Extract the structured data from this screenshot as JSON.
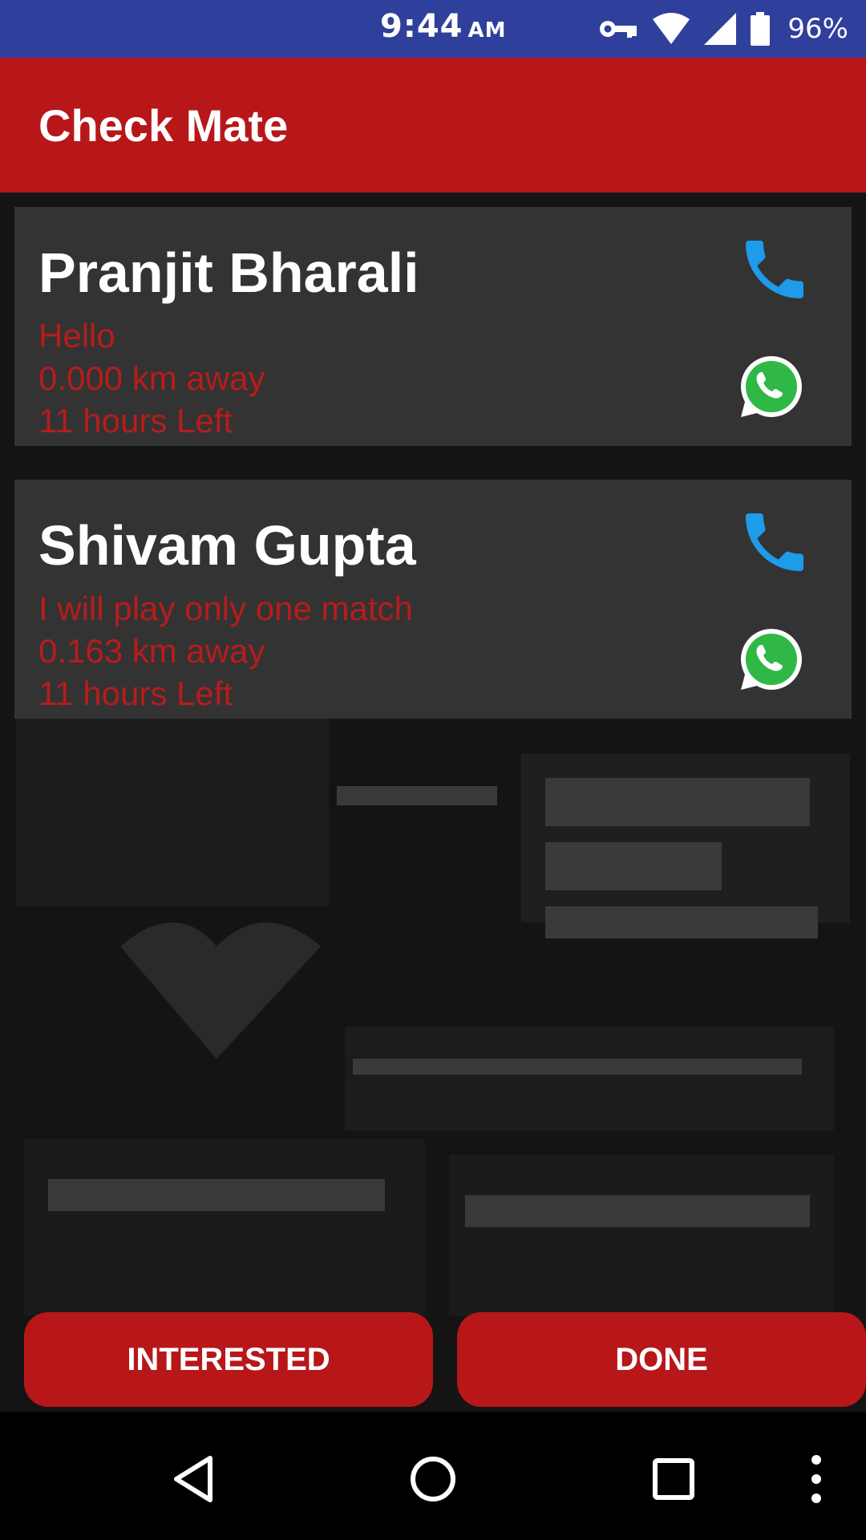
{
  "status_bar": {
    "time": "9:44",
    "ampm": "AM",
    "battery": "96%",
    "icons": [
      "vpn-key-icon",
      "wifi-icon",
      "signal-icon",
      "battery-icon"
    ]
  },
  "app_bar": {
    "title": "Check Mate"
  },
  "cards": [
    {
      "name": "Pranjit Bharali",
      "message": "Hello",
      "distance": "0.000 km away",
      "time_left": "11 hours Left",
      "actions": [
        "phone-icon",
        "whatsapp-icon"
      ]
    },
    {
      "name": "Shivam Gupta",
      "message": "I will play only one match",
      "distance": "0.163 km away",
      "time_left": "11 hours Left",
      "actions": [
        "phone-icon",
        "whatsapp-icon"
      ]
    }
  ],
  "buttons": {
    "interested": "INTERESTED",
    "done": "DONE"
  },
  "nav_bar": {
    "icons": [
      "back-icon",
      "home-icon",
      "recents-icon",
      "overflow-menu-icon"
    ]
  },
  "colors": {
    "status_bar": "#2f3f9c",
    "primary": "#b71719",
    "card_bg": "#333333",
    "card_text": "#b71c1c",
    "phone_icon": "#1e9be9",
    "whatsapp": "#2fb845"
  }
}
